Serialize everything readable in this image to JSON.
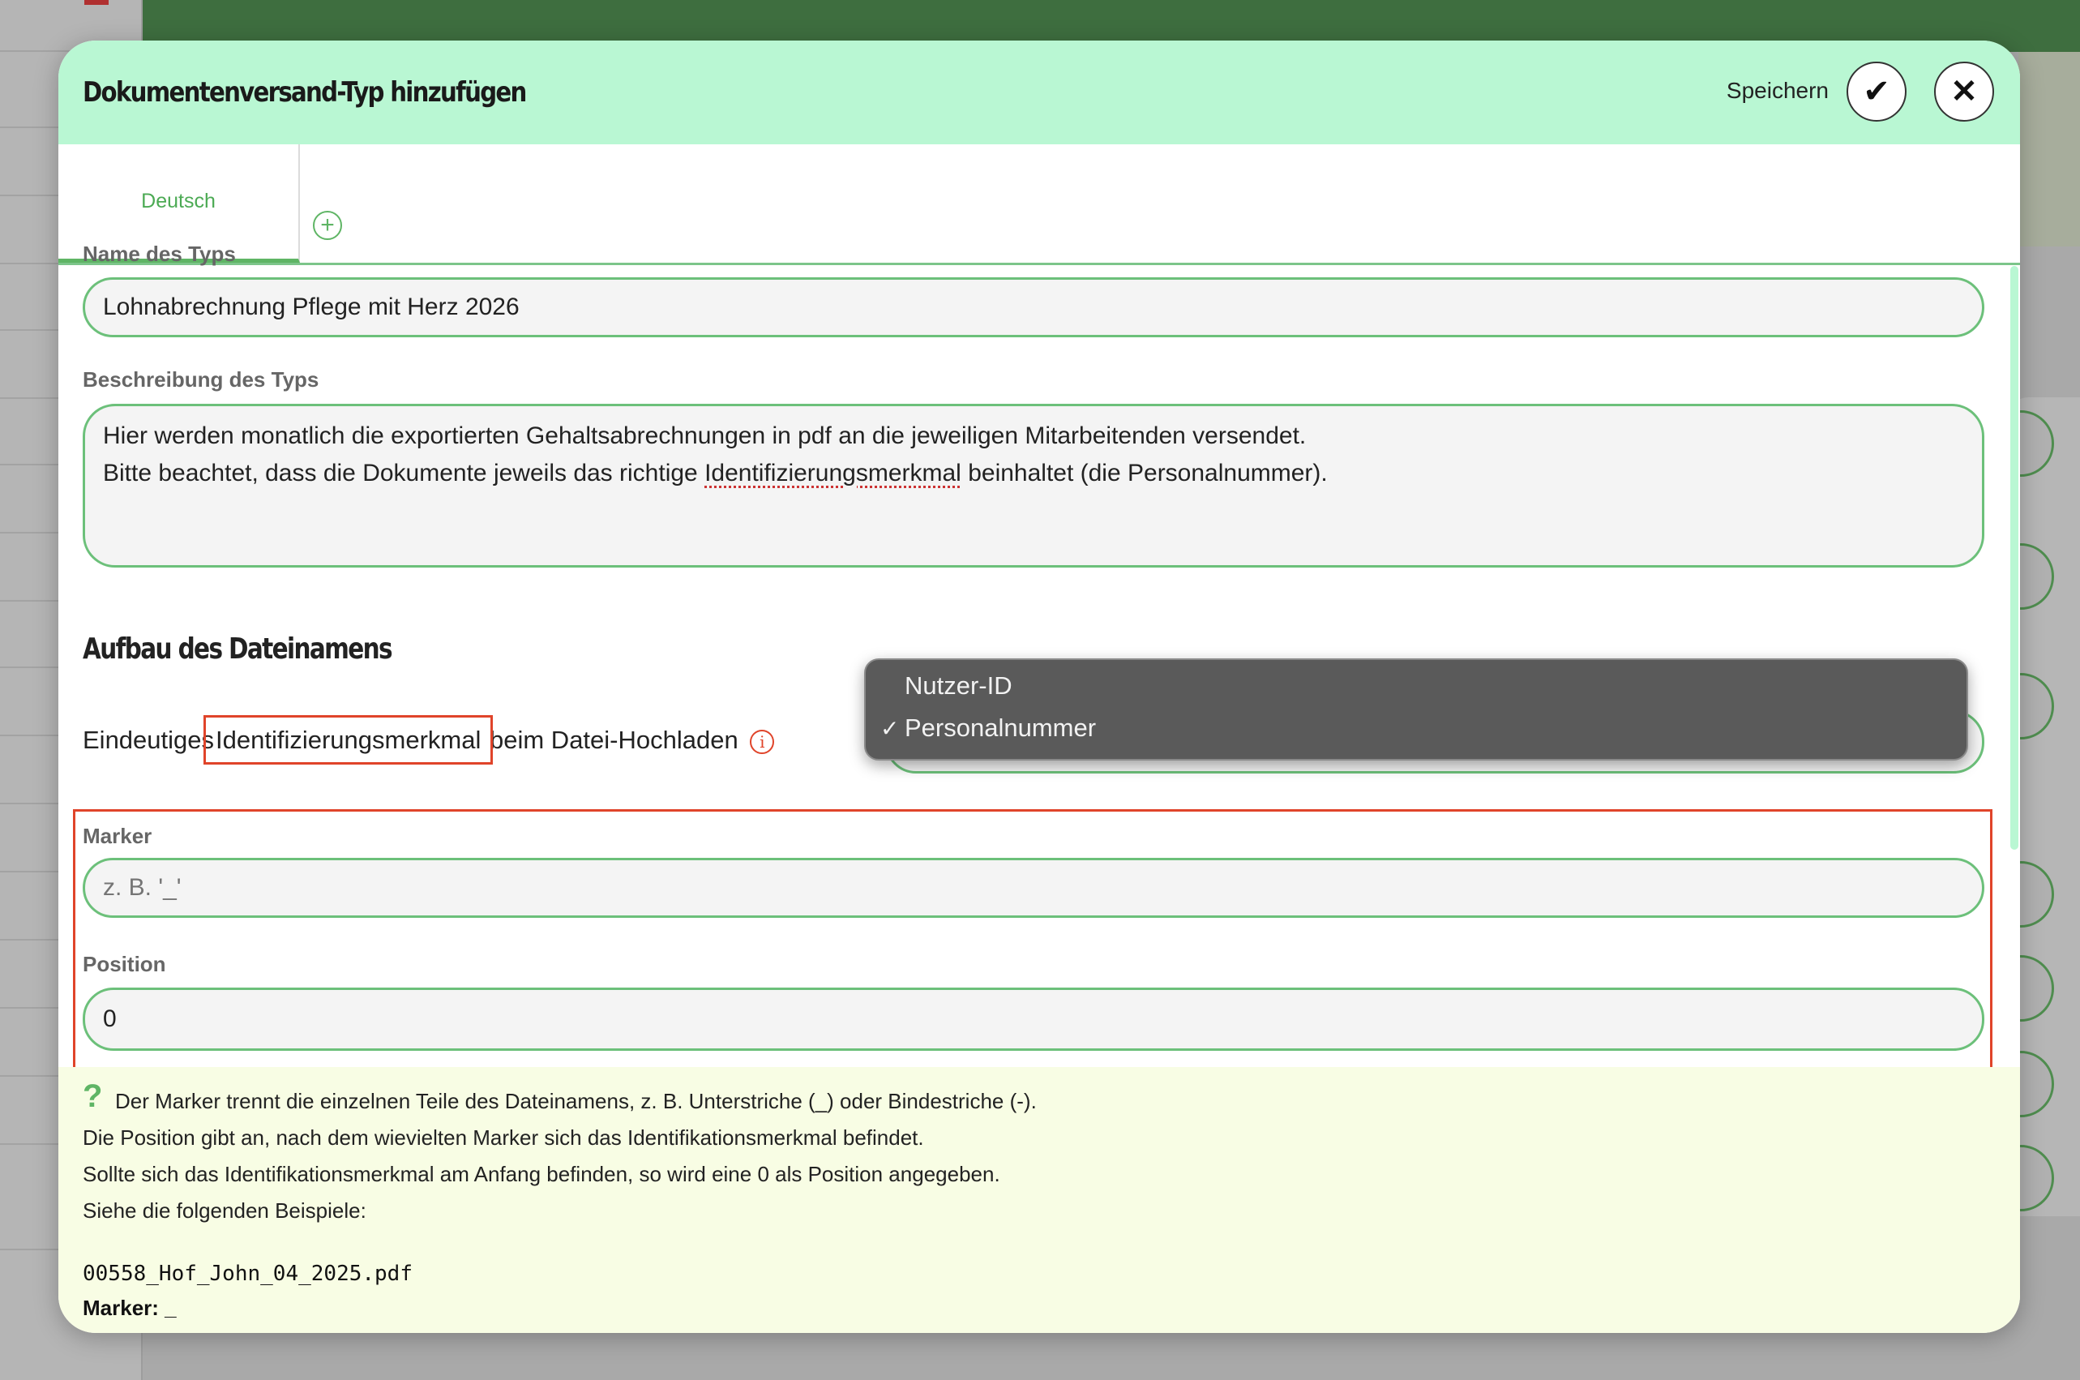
{
  "modal": {
    "title": "Dokumentenversand-Typ hinzufügen",
    "save_label": "Speichern",
    "save_icon": "check-icon",
    "close_icon": "close-icon"
  },
  "tabs": {
    "items": [
      {
        "label": "Deutsch",
        "active": true
      }
    ],
    "add_icon": "plus-circle-icon"
  },
  "form": {
    "name_label": "Name des Typs",
    "name_value": "Lohnabrechnung Pflege mit Herz 2026",
    "description_label": "Beschreibung des Typs",
    "description_line1": "Hier werden monatlich die exportierten Gehaltsabrechnungen in pdf an die jeweiligen Mitarbeitenden versendet.",
    "description_line2_before": "Bitte beachtet, dass die Dokumente jeweils das richtige ",
    "description_line2_word": "Identifizierungsmerkmal",
    "description_line2_after": " beinhaltet (die Personalnummer).",
    "section_title": "Aufbau des Dateinamens",
    "ident_prefix": "Eindeutiges",
    "ident_highlight": "Identifizierungsmerkmal",
    "ident_suffix": "beim Datei-Hochladen",
    "info_icon": "info-icon",
    "ident_options": [
      "Nutzer-ID",
      "Personalnummer"
    ],
    "ident_selected": "Personalnummer",
    "marker_label": "Marker",
    "marker_placeholder": "z. B. '_'",
    "marker_value": "",
    "position_label": "Position",
    "position_value": "0"
  },
  "help": {
    "icon": "question-icon",
    "lines": [
      "Der Marker trennt die einzelnen Teile des Dateinamens, z. B. Unterstriche (_) oder Bindestriche (-).",
      "Die Position gibt an, nach dem wievielten Marker sich das Identifikationsmerkmal befindet.",
      "Sollte sich das Identifikationsmerkmal am Anfang befinden, so wird eine 0 als Position angegeben.",
      "Siehe die folgenden Beispiele:"
    ],
    "example_file": "00558_Hof_John_04_2025.pdf",
    "example_marker_label": "Marker:",
    "example_marker_value": "_"
  },
  "colors": {
    "header_bg": "#b9f7d3",
    "accent_green": "#5fb565",
    "highlight_red": "#e0442a",
    "help_bg": "#f8fde4"
  }
}
